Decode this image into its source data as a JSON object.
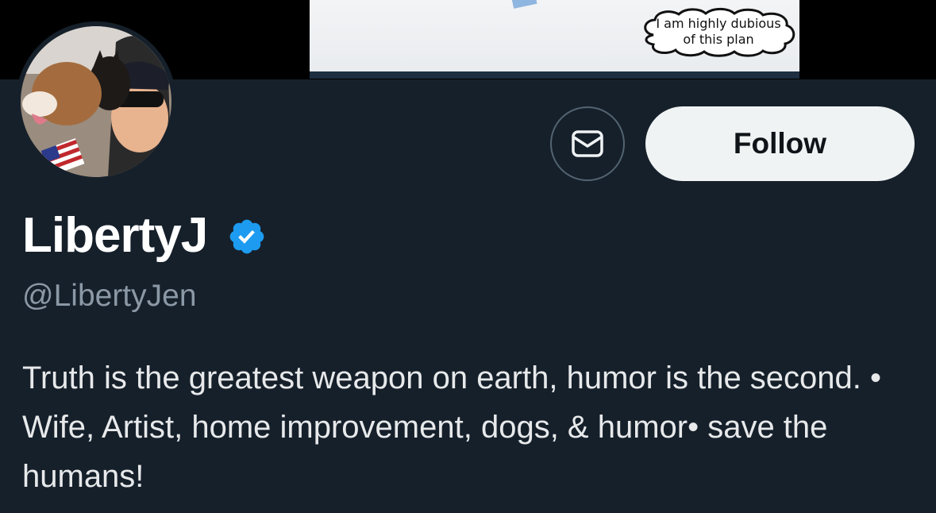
{
  "banner": {
    "thought_bubble_line1": "I am highly dubious",
    "thought_bubble_line2": "of this plan"
  },
  "profile": {
    "display_name": "LibertyJ",
    "handle": "@LibertyJen",
    "verified": true,
    "bio": "Truth is the greatest weapon on earth, humor is the second. • Wife, Artist, home improvement, dogs, & humor• save the humans!"
  },
  "actions": {
    "message_icon": "envelope-icon",
    "follow_label": "Follow"
  },
  "colors": {
    "background": "#16202b",
    "verified_badge": "#1d9bf0",
    "follow_bg": "#eff3f4",
    "secondary_text": "#8b98a5"
  }
}
